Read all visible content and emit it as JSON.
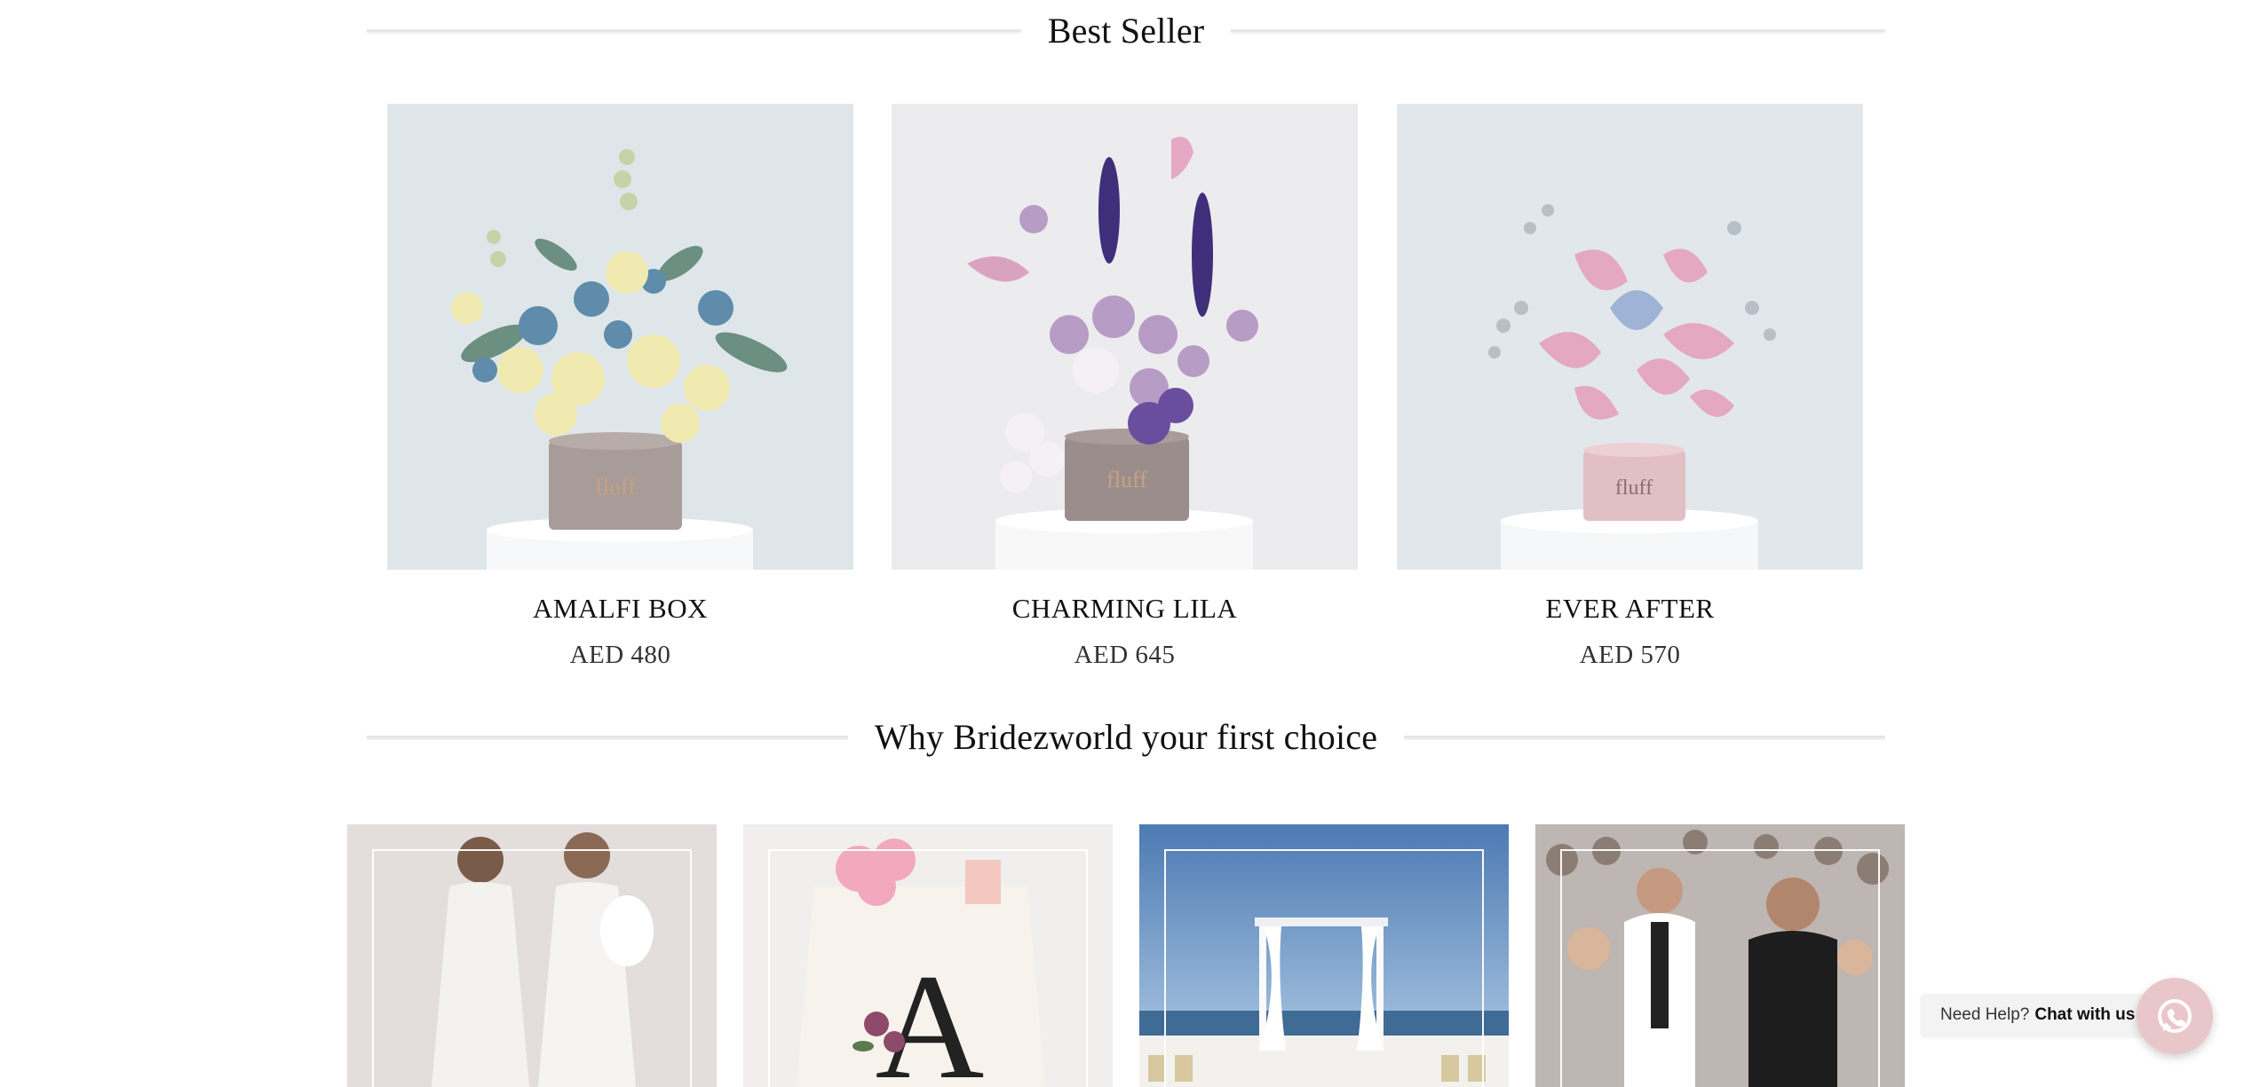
{
  "bestseller": {
    "title": "Best Seller"
  },
  "products": [
    {
      "name": "AMALFI BOX",
      "price": "AED 480",
      "box_brand": "fluff"
    },
    {
      "name": "CHARMING LILA",
      "price": "AED 645",
      "box_brand": "fluff"
    },
    {
      "name": "EVER AFTER",
      "price": "AED 570",
      "box_brand": "fluff"
    }
  ],
  "why": {
    "title": "Why Bridezworld your first choice",
    "cards": [
      {
        "icon": "bridal-dresses-photo"
      },
      {
        "icon": "monogram-tote-photo",
        "monogram": "A"
      },
      {
        "icon": "beach-ceremony-photo"
      },
      {
        "icon": "wedding-celebration-photo"
      }
    ]
  },
  "chat": {
    "prompt": "Need Help?",
    "action": "Chat with us",
    "icon": "whatsapp-icon"
  },
  "colors": {
    "rule": "#e6e6e6",
    "chat_button": "#e9c6ca"
  }
}
